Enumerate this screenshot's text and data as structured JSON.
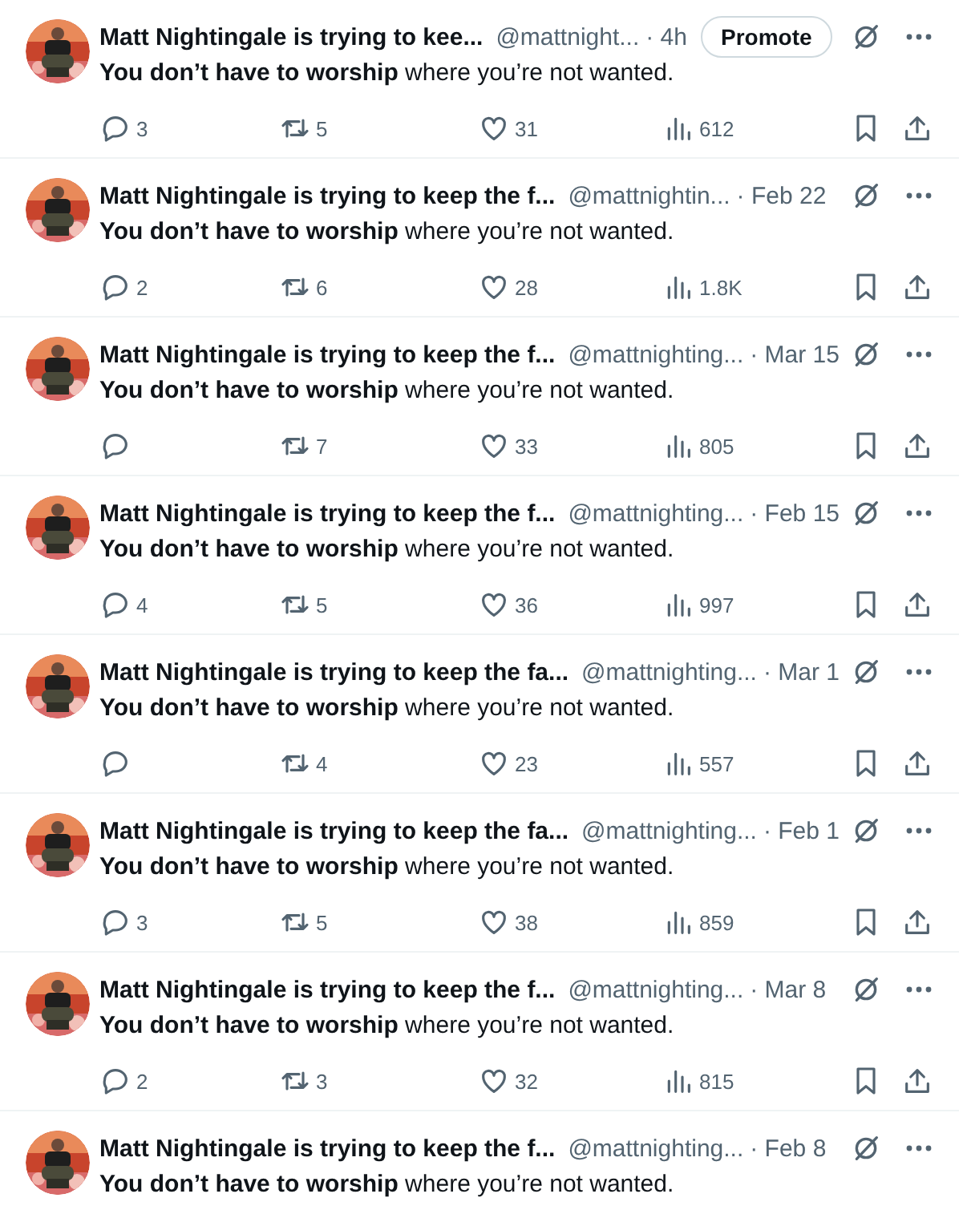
{
  "tweets": [
    {
      "name": "Matt Nightingale is trying to kee...",
      "handle": "@mattnight...",
      "time": "· 4h",
      "promote": "Promote",
      "text": "**You don’t have to worship** where you’re not wanted.",
      "stats": {
        "replies": "3",
        "reposts": "5",
        "likes": "31",
        "views": "612"
      }
    },
    {
      "name": "Matt Nightingale is trying to keep the f...",
      "handle": "@mattnightin...",
      "time": "· Feb 22",
      "text": "**You don’t have to worship** where you’re not wanted.",
      "stats": {
        "replies": "2",
        "reposts": "6",
        "likes": "28",
        "views": "1.8K"
      }
    },
    {
      "name": "Matt Nightingale is trying to keep the f...",
      "handle": "@mattnighting...",
      "time": "· Mar 15",
      "text": "**You don’t have to worship** where you’re not wanted.",
      "stats": {
        "reposts": "7",
        "likes": "33",
        "views": "805"
      }
    },
    {
      "name": "Matt Nightingale is trying to keep the f...",
      "handle": "@mattnighting...",
      "time": "· Feb 15",
      "text": "**You don’t have to worship** where you’re not wanted.",
      "stats": {
        "replies": "4",
        "reposts": "5",
        "likes": "36",
        "views": "997"
      }
    },
    {
      "name": "Matt Nightingale is trying to keep the fa...",
      "handle": "@mattnighting...",
      "time": "· Mar 1",
      "text": "**You don’t have to worship** where you’re not wanted.",
      "stats": {
        "reposts": "4",
        "likes": "23",
        "views": "557"
      }
    },
    {
      "name": "Matt Nightingale is trying to keep the fa...",
      "handle": "@mattnighting...",
      "time": "· Feb 1",
      "text": "**You don’t have to worship** where you’re not wanted.",
      "stats": {
        "replies": "3",
        "reposts": "5",
        "likes": "38",
        "views": "859"
      }
    },
    {
      "name": "Matt Nightingale is trying to keep the f...",
      "handle": "@mattnighting...",
      "time": "· Mar 8",
      "text": "**You don’t have to worship** where you’re not wanted.",
      "stats": {
        "replies": "2",
        "reposts": "3",
        "likes": "32",
        "views": "815"
      }
    },
    {
      "name": "Matt Nightingale is trying to keep the f...",
      "handle": "@mattnighting...",
      "time": "· Feb 8",
      "text": "**You don’t have to worship** where you’re not wanted."
    }
  ]
}
